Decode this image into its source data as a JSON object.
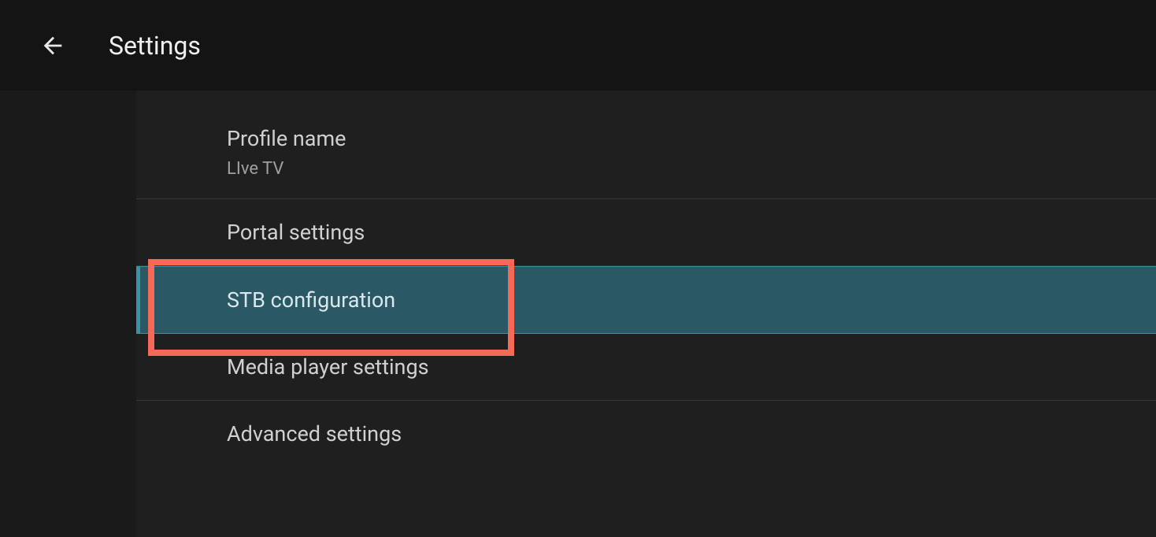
{
  "header": {
    "title": "Settings"
  },
  "settings": {
    "items": [
      {
        "title": "Profile name",
        "subtitle": "LIve TV",
        "selected": false
      },
      {
        "title": "Portal settings",
        "subtitle": null,
        "selected": false
      },
      {
        "title": "STB configuration",
        "subtitle": null,
        "selected": true
      },
      {
        "title": "Media player settings",
        "subtitle": null,
        "selected": false
      },
      {
        "title": "Advanced settings",
        "subtitle": null,
        "selected": false
      }
    ]
  }
}
